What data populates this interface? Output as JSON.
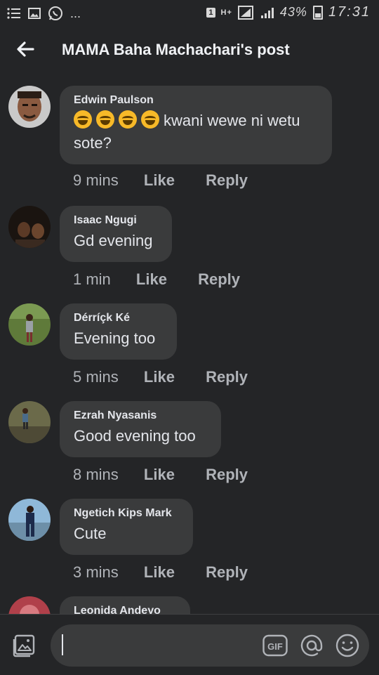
{
  "status_bar": {
    "left_icons": [
      "menu-lines-icon",
      "image-icon",
      "whatsapp-icon",
      "more-dots-icon"
    ],
    "more": "...",
    "sim": "1",
    "network": "H+",
    "battery_percent": "43%",
    "time": "17:31"
  },
  "header": {
    "title": "MAMA Baha Machachari's post",
    "back_icon": "arrow-left-icon"
  },
  "comments": [
    {
      "author": "Edwin Paulson",
      "text": "kwani wewe ni wetu sote?",
      "emoji_count": 4,
      "time": "9 mins",
      "like": "Like",
      "reply": "Reply"
    },
    {
      "author": "Isaac Ngugi",
      "text": "Gd evening",
      "time": "1 min",
      "like": "Like",
      "reply": "Reply"
    },
    {
      "author": "Dérríçk Ké",
      "text": "Evening too",
      "time": "5 mins",
      "like": "Like",
      "reply": "Reply"
    },
    {
      "author": "Ezrah Nyasanis",
      "text": "Good evening too",
      "time": "8 mins",
      "like": "Like",
      "reply": "Reply"
    },
    {
      "author": "Ngetich Kips Mark",
      "text": "Cute",
      "time": "3 mins",
      "like": "Like",
      "reply": "Reply"
    },
    {
      "author": "Leonida Andeyo"
    }
  ],
  "composer": {
    "photo_icon": "photo-gallery-icon",
    "gif_label": "GIF",
    "mention_icon": "at-sign-icon",
    "emoji_icon": "smiley-icon",
    "placeholder": ""
  },
  "colors": {
    "background": "#242527",
    "bubble": "#3a3b3c",
    "text": "#e4e6eb",
    "secondary_text": "#b0b3b8"
  }
}
